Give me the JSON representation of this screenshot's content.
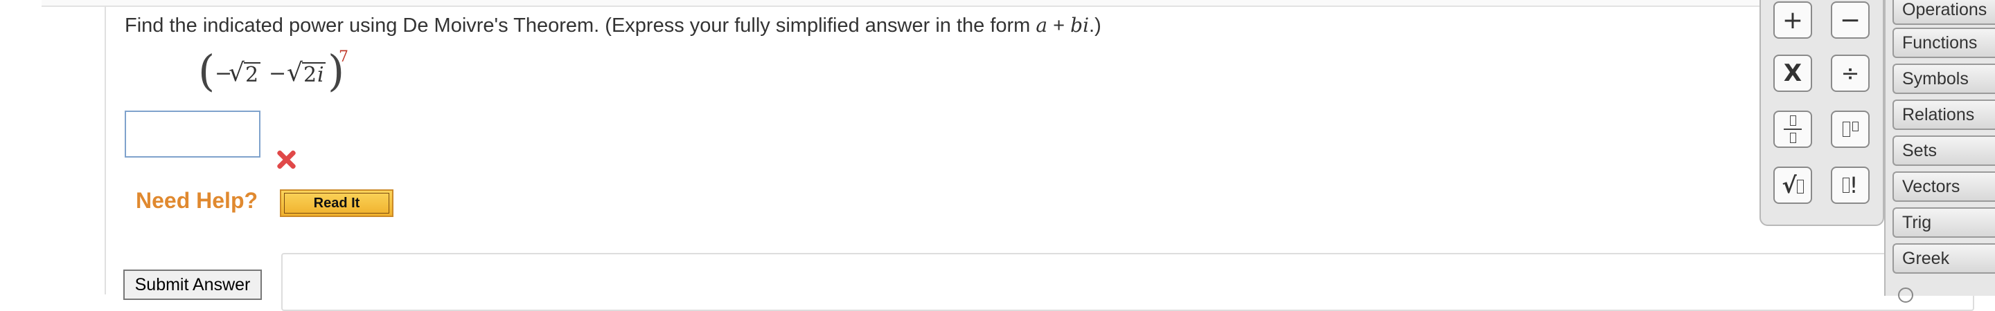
{
  "question": {
    "prefix": "Find the indicated power using De Moivre's Theorem. (Express your fully simplified answer in the form ",
    "form_a": "a",
    "form_plus": " + ",
    "form_bi": "bi",
    "suffix": ".)"
  },
  "expression": {
    "open_paren": "(",
    "neg": "−",
    "radical": "√",
    "radicand": "2",
    "minus": "−",
    "radicand2": "2",
    "imag": "i",
    "close_paren": ")",
    "exponent": "7"
  },
  "answer": {
    "value": "",
    "status": "incorrect"
  },
  "help": {
    "need_help": "Need Help?",
    "read_it": "Read It"
  },
  "submit_label": "Submit Answer",
  "palette": {
    "plus": "+",
    "minus": "−",
    "times": "X",
    "divide": "÷",
    "sqrt": "√",
    "factorial": "!"
  },
  "tabs": [
    "Operations",
    "Functions",
    "Symbols",
    "Relations",
    "Sets",
    "Vectors",
    "Trig",
    "Greek"
  ],
  "colors": {
    "error": "#e04848",
    "help_text": "#e0892f",
    "button_gold": "#f0b12c",
    "exponent": "#c0392b",
    "input_border": "#7fa2cc"
  }
}
